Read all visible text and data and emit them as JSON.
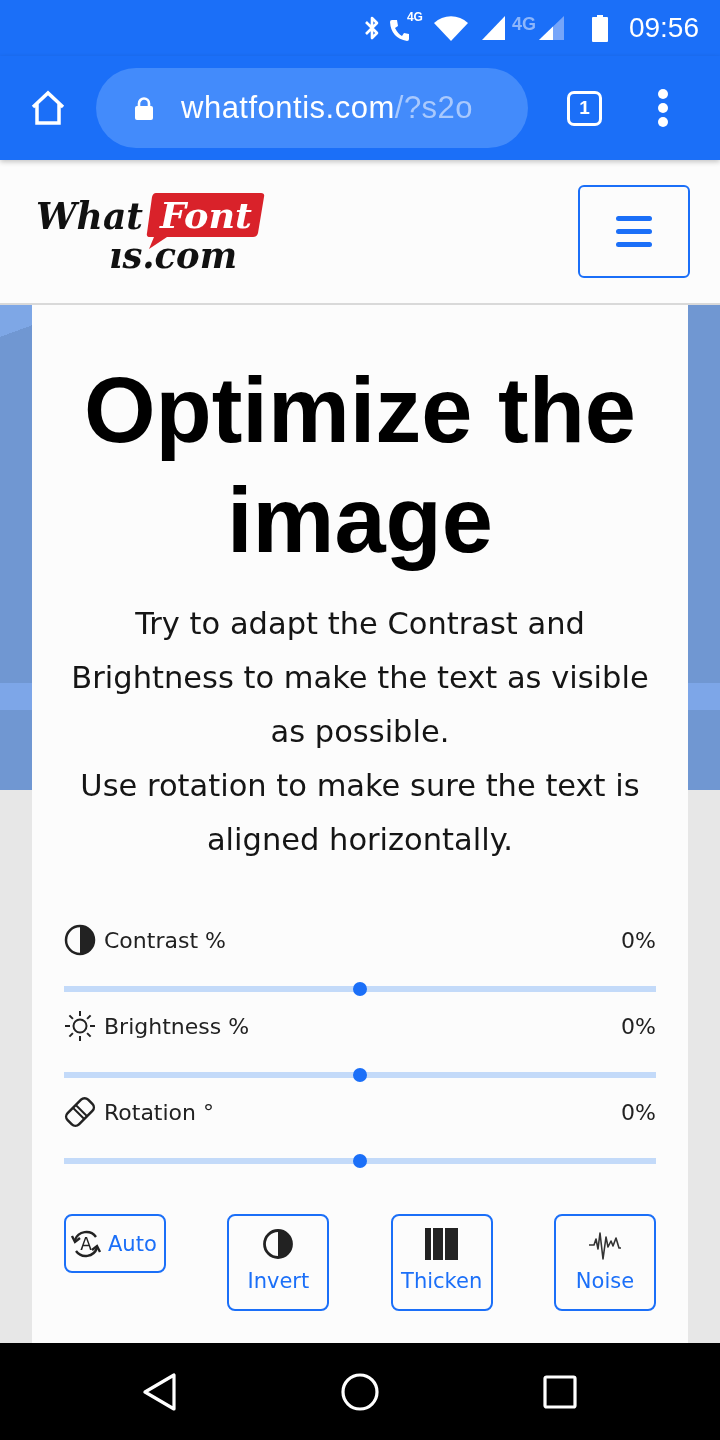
{
  "status_bar": {
    "call_badge": "4G",
    "network_badge": "4G",
    "time": "09:56"
  },
  "browser_toolbar": {
    "url": {
      "host": "whatfontis.com",
      "path": "/?s2o"
    },
    "tab_count": "1"
  },
  "site_header": {
    "logo": {
      "word_1": "What",
      "badge": "Font",
      "word_2": "ıs.com"
    }
  },
  "card": {
    "title": "Optimize the image",
    "paragraphs": [
      "Try to adapt the Contrast and Brightness to make the text as visible as possible.",
      "Use rotation to make sure the text is aligned horizontally."
    ],
    "sliders": [
      {
        "label": "Contrast %",
        "reading": "0%",
        "level": 0.5
      },
      {
        "label": "Brightness %",
        "reading": "0%",
        "level": 0.5
      },
      {
        "label": "Rotation °",
        "reading": "0%",
        "level": 0.5
      }
    ],
    "buttons": [
      {
        "label": "Auto",
        "kind": "inline",
        "icon_letter": "A"
      },
      {
        "label": "Invert",
        "kind": "stacked"
      },
      {
        "label": "Thicken",
        "kind": "stacked"
      },
      {
        "label": "Noise",
        "kind": "stacked"
      }
    ]
  }
}
